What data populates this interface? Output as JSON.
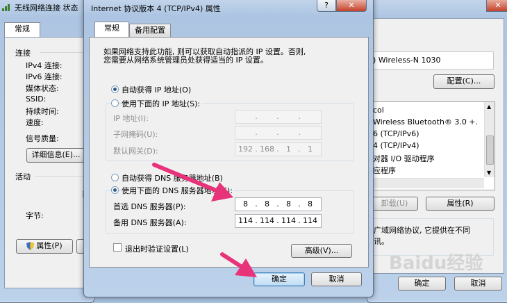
{
  "left_window": {
    "title": "无线网络连接 状态",
    "tab": "常规",
    "section_connection": "连接",
    "rows": [
      {
        "label": "IPv4 连接:"
      },
      {
        "label": "IPv6 连接:"
      },
      {
        "label": "媒体状态:"
      },
      {
        "label": "SSID:"
      },
      {
        "label": "持续时间:"
      },
      {
        "label": "速度:"
      }
    ],
    "signal_label": "信号质量:",
    "details_button": "详细信息(E)...",
    "section_activity": "活动",
    "activity_partial": "已",
    "bytes_label": "字节:",
    "properties_button": "属性(P)"
  },
  "right_window": {
    "adapter_name": ") Wireless-N 1030",
    "configure_button": "配置(C)...",
    "items": [
      "col",
      "Wireless Bluetooth® 3.0 +.",
      "6 (TCP/IPv6)",
      "4 (TCP/IPv4)",
      "对器 I/O 驱动程序",
      "应程序"
    ],
    "uninstall_button": "卸载(U)",
    "properties_button": "属性(R)",
    "description_line1": "广域网络协议, 它提供在不同",
    "description_line2": "讯。",
    "ok_button": "确定",
    "cancel_button": "取消",
    "watermark": "Baidu经验"
  },
  "dialog": {
    "title": "Internet 协议版本 4 (TCP/IPv4) 属性",
    "help_btn": "?",
    "close_btn": "✕",
    "tabs": [
      "常规",
      "备用配置"
    ],
    "description_line1": "如果网络支持此功能, 则可以获取自动指派的 IP 设置。否则,",
    "description_line2": "您需要从网络系统管理员处获得适当的 IP 设置。",
    "auto_ip": "自动获得 IP 地址(O)",
    "manual_ip": "使用下面的 IP 地址(S):",
    "ip_label": "IP 地址(I):",
    "mask_label": "子网掩码(U):",
    "gateway_label": "默认网关(D):",
    "ip_fields": [
      "",
      "",
      "",
      ""
    ],
    "mask_fields": [
      "",
      "",
      "",
      ""
    ],
    "gateway_fields": [
      "192",
      "168",
      "1",
      "1"
    ],
    "auto_dns": "自动获得 DNS 服务器地址(B)",
    "manual_dns": "使用下面的 DNS 服务器地址(E):",
    "preferred_dns_label": "首选 DNS 服务器(P):",
    "alternate_dns_label": "备用 DNS 服务器(A):",
    "preferred_dns": [
      "8",
      "8",
      "8",
      "8"
    ],
    "alternate_dns": [
      "114",
      "114",
      "114",
      "114"
    ],
    "validate_on_exit": "退出时验证设置(L)",
    "advanced_button": "高级(V)...",
    "ok_button": "确定",
    "cancel_button": "取消"
  },
  "colors": {
    "arrow": "#e8327a",
    "frame": "#adc5e2",
    "panel": "#f0f0f0"
  }
}
